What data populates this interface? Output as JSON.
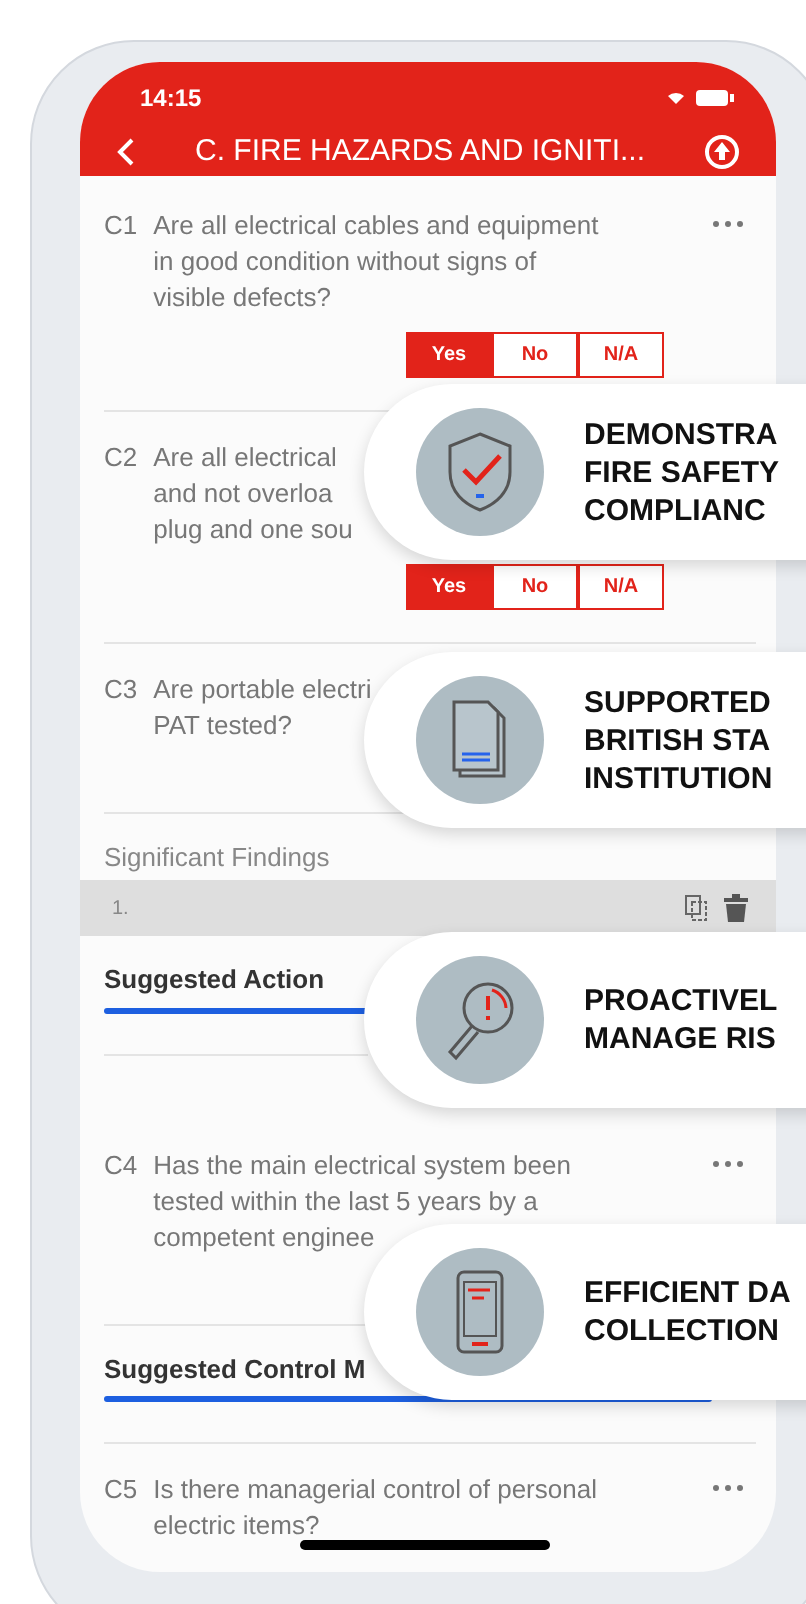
{
  "status_bar": {
    "time": "14:15"
  },
  "header": {
    "title": "C. FIRE HAZARDS AND IGNITI..."
  },
  "questions": [
    {
      "kind": "question",
      "number": "C1",
      "menu": true,
      "lines": [
        "Are all electrical cables and equipment",
        "in good condition without signs of",
        "visible defects?"
      ],
      "answers": [
        {
          "label": "Yes",
          "selected": true
        },
        {
          "label": "No",
          "selected": false
        },
        {
          "label": "N/A",
          "selected": false
        }
      ]
    },
    {
      "kind": "question",
      "number": "C2",
      "lines": [
        "Are all electrical",
        "and not overloa",
        "plug and one sou"
      ],
      "answers": [
        {
          "label": "Yes",
          "selected": true
        },
        {
          "label": "No",
          "selected": false
        },
        {
          "label": "N/A",
          "selected": false
        }
      ]
    },
    {
      "kind": "question",
      "number": "C3",
      "lines": [
        "Are portable electri",
        "PAT tested?"
      ]
    },
    {
      "kind": "findings",
      "label": "Significant Findings",
      "row": "1.",
      "field": "Suggested Action"
    },
    {
      "kind": "question",
      "number": "C4",
      "menu": true,
      "lines": [
        "Has the main electrical system been",
        "tested within the last 5 years by a",
        "competent enginee"
      ]
    },
    {
      "kind": "field",
      "field": "Suggested Control M"
    },
    {
      "kind": "question",
      "number": "C5",
      "menu": true,
      "lines": [
        "Is there managerial control of personal",
        "electric items?"
      ]
    }
  ],
  "callouts": [
    {
      "kind": "shield",
      "lines": [
        "DEMONSTRA",
        "FIRE SAFETY",
        "COMPLIANC"
      ]
    },
    {
      "kind": "document",
      "lines": [
        "SUPPORTED",
        "BRITISH STA",
        "INSTITUTION"
      ]
    },
    {
      "kind": "magnifier",
      "lines": [
        "PROACTIVEL",
        "MANAGE RIS"
      ]
    },
    {
      "kind": "phone",
      "lines": [
        "EFFICIENT DA",
        "COLLECTION"
      ]
    }
  ]
}
